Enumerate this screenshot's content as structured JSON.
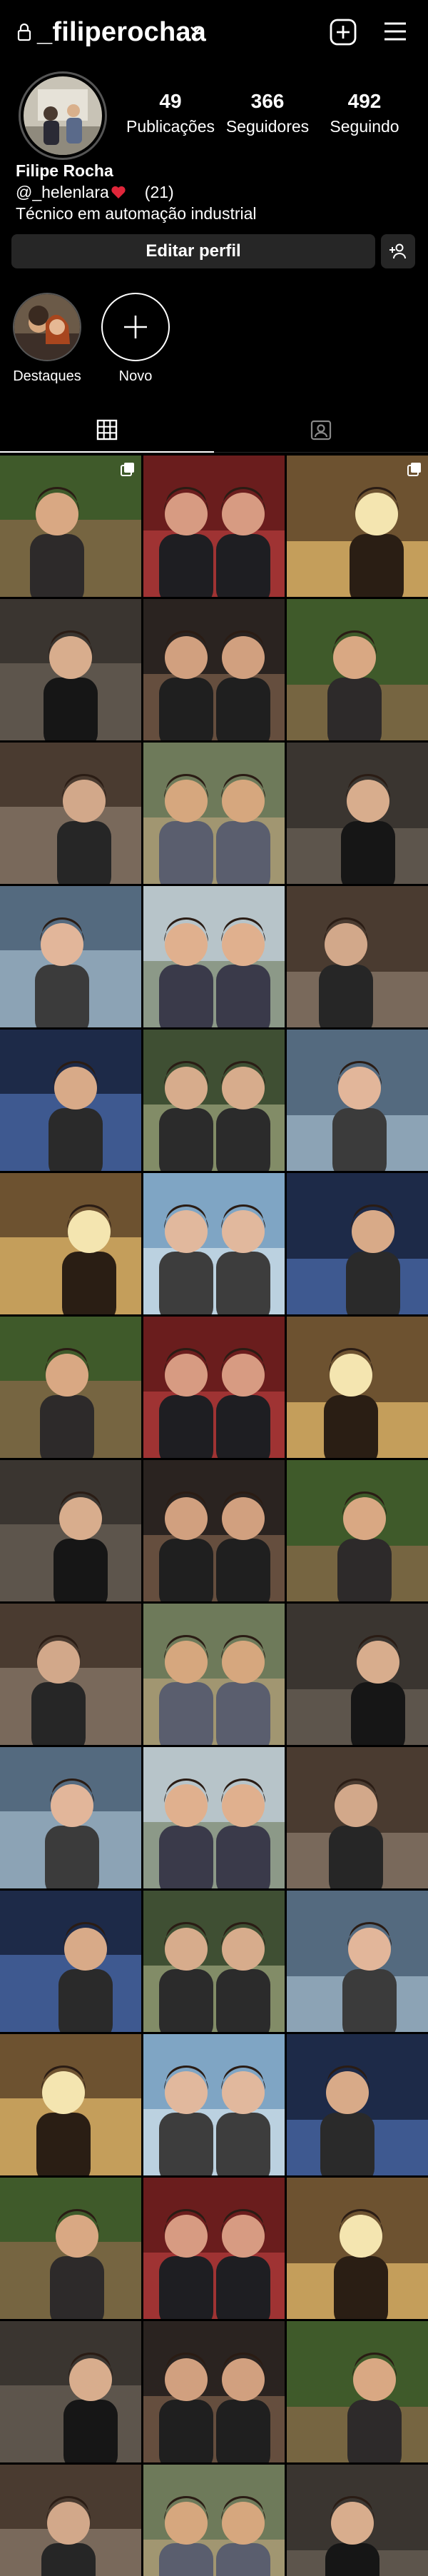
{
  "header": {
    "username": "_filiperochaa",
    "icons": [
      "lock-icon",
      "chevron-down-icon",
      "add-post-icon",
      "menu-icon"
    ]
  },
  "profile": {
    "stats": {
      "posts": {
        "value": "49",
        "label": "Publicações"
      },
      "followers": {
        "value": "366",
        "label": "Seguidores"
      },
      "following": {
        "value": "492",
        "label": "Seguindo"
      }
    },
    "full_name": "Filipe Rocha",
    "handle": "@_helenlara",
    "handle_count": "(21)",
    "bio": "Técnico em automação industrial",
    "edit_button": "Editar perfil"
  },
  "stories": {
    "highlights_label": "Destaques",
    "new_label": "Novo"
  },
  "tabs": [
    "grid-icon",
    "tagged-icon"
  ],
  "grid": {
    "rows": 15,
    "columns": 3,
    "multi_photo_cells": [
      0,
      2
    ]
  }
}
